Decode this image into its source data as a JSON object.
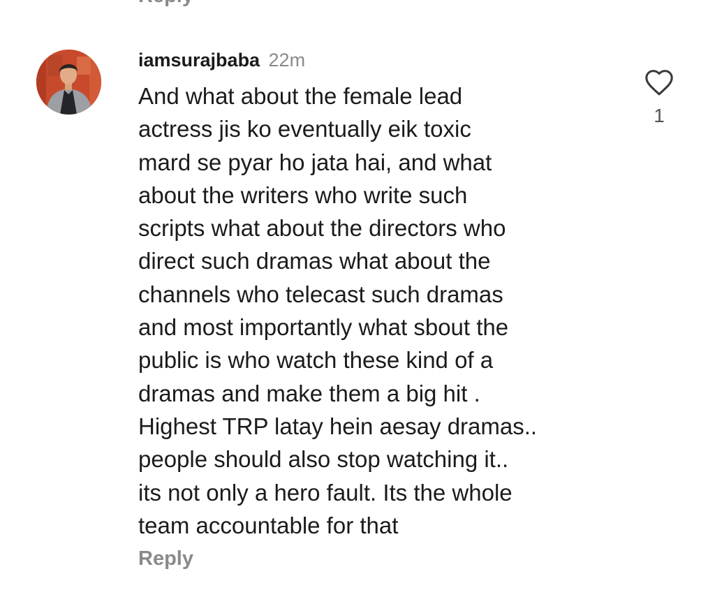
{
  "previous_comment": {
    "reply_label": "Reply"
  },
  "comment": {
    "username": "iamsurajbaba",
    "timestamp": "22m",
    "text_lines": [
      "And what about the female lead",
      "actress jis ko eventually eik toxic",
      "mard se pyar ho jata hai, and what",
      "about the writers who write such",
      "scripts what about the directors who",
      "direct such dramas what about the",
      "channels who telecast such dramas",
      "and most importantly what sbout the",
      "public is who watch these kind of a",
      "dramas and make them a big hit .",
      "Highest TRP latay hein aesay dramas..",
      "people should also stop watching it..",
      "its not only a hero fault. Its the whole",
      "team accountable for that"
    ],
    "reply_label": "Reply",
    "like_count": "1",
    "like_icon": "heart-outline-icon"
  },
  "colors": {
    "text": "#1b1b1b",
    "muted": "#8a8a8a",
    "background": "#ffffff"
  }
}
